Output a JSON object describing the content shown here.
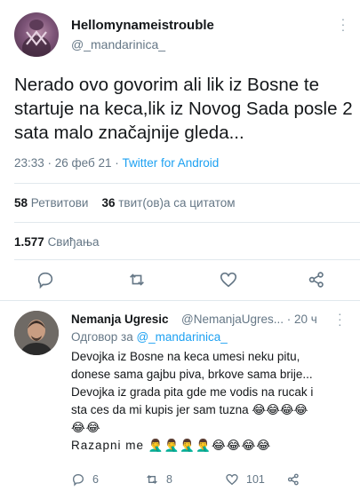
{
  "main_tweet": {
    "display_name": "Hellomynameistrouble",
    "handle": "@_mandarinica_",
    "text": "Nerado ovo govorim ali lik iz Bosne te startuje na keca,lik iz Novog Sada posle 2 sata malo značajnije gleda...",
    "meta_time": "23:33 · 26 феб 21 · ",
    "meta_source": "Twitter for Android",
    "retweets_count": "58",
    "retweets_label": "Ретвитови",
    "quotes_count": "36",
    "quotes_label": "твит(ов)а са цитатом",
    "likes_count": "1.577",
    "likes_label": "Свиђања"
  },
  "reply": {
    "display_name": "Nemanja Ugresic",
    "handle_time": "@NemanjaUgres... · 20 ч",
    "reply_to_prefix": "Одговор за ",
    "reply_to_handle": "@_mandarinica_",
    "line1": "Devojka iz Bosne na keca umesi neku pitu,",
    "line2": "donese sama gajbu piva, brkove sama brije...",
    "line3": "Devojka iz grada pita gde me vodis na rucak i",
    "line4": "sta ces da mi kupis jer sam tuzna 😂😂😂😂",
    "line5": "😂😂",
    "line6": "Razapni me 🤦‍♂️🤦‍♂️🤦‍♂️🤦‍♂️😂😂😂😂",
    "replies_count": "6",
    "retweets_count": "8",
    "likes_count": "101"
  },
  "icons": {
    "more": "more-vertical-icon",
    "reply": "reply-icon",
    "retweet": "retweet-icon",
    "like": "heart-icon",
    "share": "share-icon"
  },
  "colors": {
    "accent": "#1da1f2",
    "secondary_text": "#657786",
    "primary_text": "#14171a",
    "divider": "#e1e8ed"
  }
}
